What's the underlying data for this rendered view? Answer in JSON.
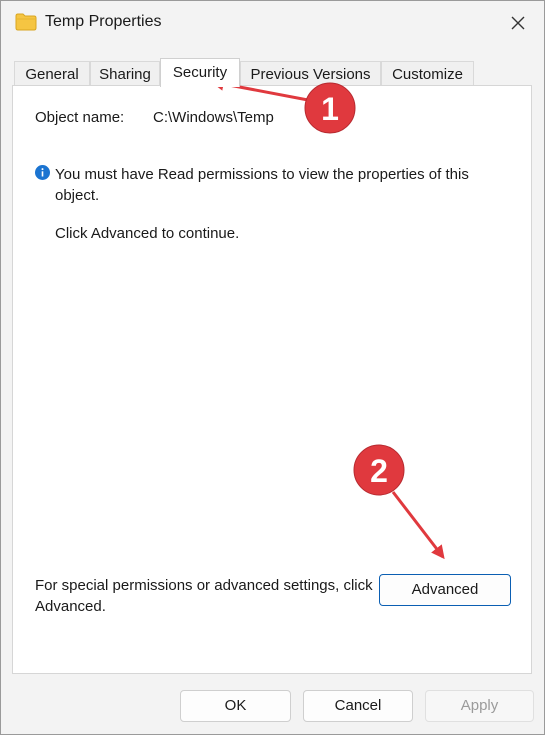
{
  "window": {
    "title": "Temp Properties"
  },
  "tabs": [
    {
      "label": "General"
    },
    {
      "label": "Sharing"
    },
    {
      "label": "Security",
      "active": true
    },
    {
      "label": "Previous Versions"
    },
    {
      "label": "Customize"
    }
  ],
  "security": {
    "object_name_label": "Object name:",
    "object_name_value": "C:\\Windows\\Temp",
    "info_text": "You must have Read permissions to view the properties of this object.",
    "continue_text": "Click Advanced to continue.",
    "special_text": "For special permissions or advanced settings, click Advanced.",
    "advanced_button": "Advanced"
  },
  "footer": {
    "ok": "OK",
    "cancel": "Cancel",
    "apply": "Apply",
    "apply_enabled": false
  },
  "annotations": [
    {
      "number": "1"
    },
    {
      "number": "2"
    }
  ],
  "colors": {
    "annotation_red": "#e0393e",
    "info_blue": "#1b74d1",
    "folder_yellow": "#f5c542",
    "accent_border": "#0b5fb3"
  },
  "icons": {
    "folder": "folder-icon",
    "close": "close-icon",
    "info": "info-icon"
  }
}
